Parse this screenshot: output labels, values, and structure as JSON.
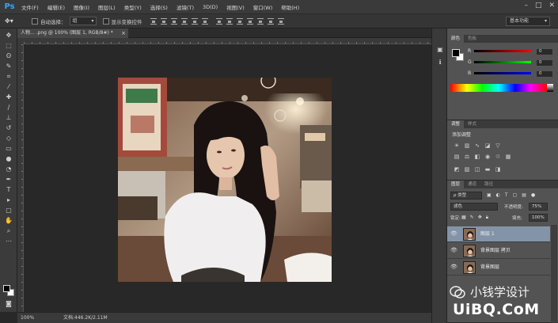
{
  "app": {
    "logo": "Ps"
  },
  "menu": [
    "文件(F)",
    "编辑(E)",
    "图像(I)",
    "图层(L)",
    "类型(Y)",
    "选择(S)",
    "滤镜(T)",
    "3D(D)",
    "视图(V)",
    "窗口(W)",
    "帮助(H)"
  ],
  "window_controls": {
    "minimize": "–",
    "maximize": "□",
    "close": "✕"
  },
  "options": {
    "auto_select_label": "自动选择：",
    "auto_select_value": "组",
    "show_transform_label": "显示变换控件",
    "workspace": "基本功能"
  },
  "document": {
    "tab_title": "人物... .png @ 100% (图层 1, RGB/8#) *",
    "close": "×",
    "zoom": "100%",
    "info": "文档:446.2K/2.11M"
  },
  "color_panel": {
    "tabs": [
      "颜色",
      "色板"
    ],
    "r_label": "R",
    "g_label": "G",
    "b_label": "B",
    "r_value": "0",
    "g_value": "0",
    "b_value": "0"
  },
  "adjustments_panel": {
    "tabs": [
      "调整",
      "样式"
    ],
    "title": "添加调整"
  },
  "layers_panel": {
    "tabs": [
      "图层",
      "通道",
      "路径"
    ],
    "filter": "ρ 类型",
    "blend_mode": "滤色",
    "opacity_label": "不透明度:",
    "opacity": "75%",
    "lock_label": "锁定:",
    "fill_label": "填充:",
    "fill": "100%",
    "layers": [
      {
        "name": "图层 1",
        "selected": true
      },
      {
        "name": "背景图层 拷贝",
        "selected": false
      },
      {
        "name": "背景图层",
        "selected": false
      }
    ]
  },
  "watermark": {
    "text": "小钱学设计",
    "site": "UiBQ.CoM"
  },
  "colors": {
    "accent": "#31a8ff",
    "panel_bg": "#535353",
    "selected_layer": "#8494a8",
    "canvas_bg": "#282828"
  }
}
